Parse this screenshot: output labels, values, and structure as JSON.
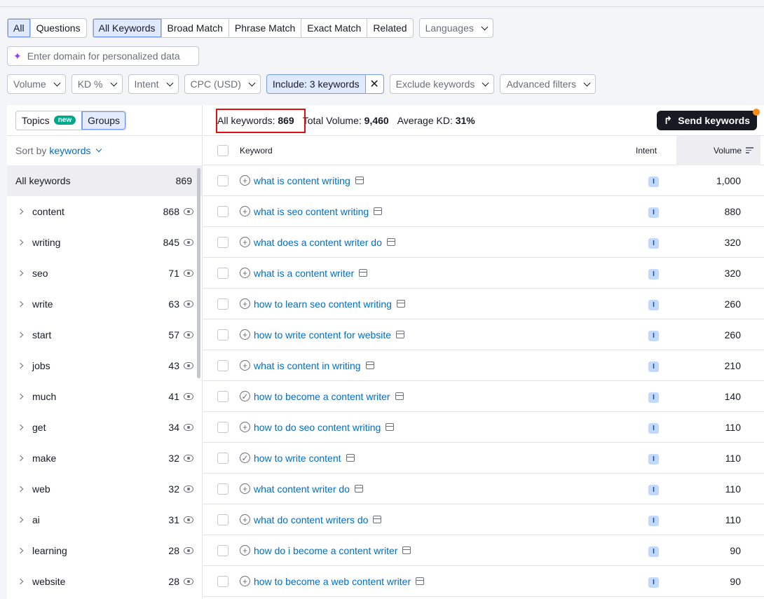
{
  "tabs_type": [
    "All",
    "Questions"
  ],
  "tabs_match": [
    "All Keywords",
    "Broad Match",
    "Phrase Match",
    "Exact Match",
    "Related"
  ],
  "languages": "Languages",
  "domain_placeholder": "Enter domain for personalized data",
  "filters": [
    "Volume",
    "KD %",
    "Intent",
    "CPC (USD)"
  ],
  "include_label": "Include: 3 keywords",
  "exclude_label": "Exclude keywords",
  "advanced_label": "Advanced filters",
  "sidebar": {
    "topics": "Topics",
    "new_badge": "new",
    "groups": "Groups",
    "sort_by": "Sort by",
    "sort_key": "keywords",
    "all_label": "All keywords",
    "all_count": "869",
    "items": [
      {
        "name": "content",
        "count": "868"
      },
      {
        "name": "writing",
        "count": "845"
      },
      {
        "name": "seo",
        "count": "71"
      },
      {
        "name": "write",
        "count": "63"
      },
      {
        "name": "start",
        "count": "57"
      },
      {
        "name": "jobs",
        "count": "43"
      },
      {
        "name": "much",
        "count": "41"
      },
      {
        "name": "get",
        "count": "34"
      },
      {
        "name": "make",
        "count": "32"
      },
      {
        "name": "web",
        "count": "32"
      },
      {
        "name": "ai",
        "count": "31"
      },
      {
        "name": "learning",
        "count": "28"
      },
      {
        "name": "website",
        "count": "28"
      }
    ]
  },
  "summary": {
    "all_label": "All keywords:",
    "all_value": "869",
    "total_label": "Total Volume:",
    "total_value": "9,460",
    "kd_label": "Average KD:",
    "kd_value": "31%",
    "send": "Send keywords"
  },
  "table": {
    "headers": {
      "keyword": "Keyword",
      "intent": "Intent",
      "volume": "Volume"
    },
    "rows": [
      {
        "keyword": "what is content writing",
        "intent": "I",
        "volume": "1,000",
        "added": false
      },
      {
        "keyword": "what is seo content writing",
        "intent": "I",
        "volume": "880",
        "added": false
      },
      {
        "keyword": "what does a content writer do",
        "intent": "I",
        "volume": "320",
        "added": false
      },
      {
        "keyword": "what is a content writer",
        "intent": "I",
        "volume": "320",
        "added": false
      },
      {
        "keyword": "how to learn seo content writing",
        "intent": "I",
        "volume": "260",
        "added": false
      },
      {
        "keyword": "how to write content for website",
        "intent": "I",
        "volume": "260",
        "added": false
      },
      {
        "keyword": "what is content in writing",
        "intent": "I",
        "volume": "210",
        "added": false
      },
      {
        "keyword": "how to become a content writer",
        "intent": "I",
        "volume": "140",
        "added": true
      },
      {
        "keyword": "how to do seo content writing",
        "intent": "I",
        "volume": "110",
        "added": false
      },
      {
        "keyword": "how to write content",
        "intent": "I",
        "volume": "110",
        "added": true
      },
      {
        "keyword": "what content writer do",
        "intent": "I",
        "volume": "110",
        "added": false
      },
      {
        "keyword": "what do content writers do",
        "intent": "I",
        "volume": "110",
        "added": false
      },
      {
        "keyword": "how do i become a content writer",
        "intent": "I",
        "volume": "90",
        "added": false
      },
      {
        "keyword": "how to become a web content writer",
        "intent": "I",
        "volume": "90",
        "added": false
      }
    ]
  }
}
